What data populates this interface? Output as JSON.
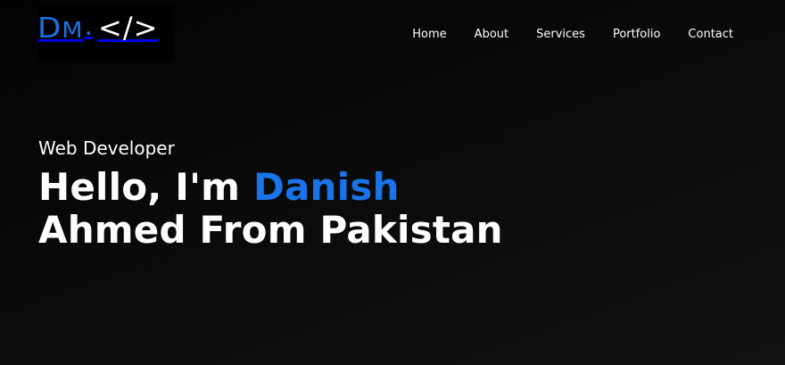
{
  "logo": {
    "initials_d": "D",
    "initials_m": "M",
    "dot": ".",
    "code_symbol": "</>"
  },
  "nav": {
    "items": [
      {
        "label": "Home"
      },
      {
        "label": "About"
      },
      {
        "label": "Services"
      },
      {
        "label": "Portfolio"
      },
      {
        "label": "Contact"
      }
    ]
  },
  "hero": {
    "role": "Web Developer",
    "greeting": "Hello, I'm ",
    "name": "Danish",
    "line2": "Ahmed From Pakistan"
  },
  "colors": {
    "accent": "#1a73e8",
    "background": "#0a0a0a",
    "text": "#ffffff"
  }
}
